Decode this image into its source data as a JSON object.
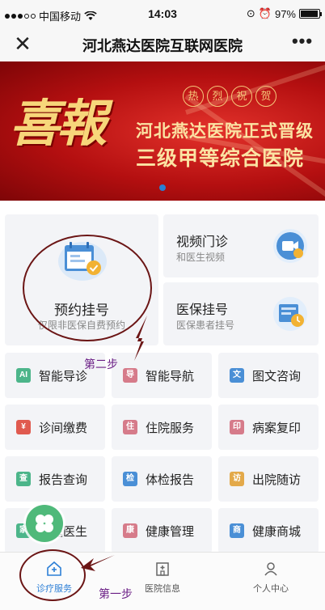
{
  "status": {
    "carrier": "中国移动",
    "time": "14:03",
    "battery": "97%"
  },
  "nav": {
    "close": "✕",
    "title": "河北燕达医院互联网医院",
    "more": "•••"
  },
  "banner": {
    "big_text": "喜報",
    "stamps": [
      "热",
      "烈",
      "祝",
      "贺"
    ],
    "line1": "河北燕达医院正式晋级",
    "line2": "三级甲等综合医院"
  },
  "services": {
    "appointment": {
      "label": "预约挂号",
      "sub": "仅限非医保自费预约"
    },
    "video": {
      "label": "视频门诊",
      "sub": "和医生视频"
    },
    "insurance": {
      "label": "医保挂号",
      "sub": "医保患者挂号"
    },
    "items": [
      {
        "label": "智能导诊",
        "icon": "AI",
        "color": "#4cb58a"
      },
      {
        "label": "智能导航",
        "icon": "导",
        "color": "#d67b8a"
      },
      {
        "label": "图文咨询",
        "icon": "文",
        "color": "#4a8fd6"
      },
      {
        "label": "诊间缴费",
        "icon": "¥",
        "color": "#e05a4f"
      },
      {
        "label": "住院服务",
        "icon": "住",
        "color": "#d67b8a"
      },
      {
        "label": "病案复印",
        "icon": "印",
        "color": "#d67b8a"
      },
      {
        "label": "报告查询",
        "icon": "查",
        "color": "#4cb58a"
      },
      {
        "label": "体检报告",
        "icon": "检",
        "color": "#4a8fd6"
      },
      {
        "label": "出院随访",
        "icon": "访",
        "color": "#e3a94a"
      },
      {
        "label": "家庭医生",
        "icon": "家",
        "color": "#4cb58a"
      },
      {
        "label": "健康管理",
        "icon": "康",
        "color": "#d67b8a"
      },
      {
        "label": "健康商城",
        "icon": "商",
        "color": "#4a8fd6"
      }
    ]
  },
  "tabs": [
    {
      "label": "诊疗服务"
    },
    {
      "label": "医院信息"
    },
    {
      "label": "个人中心"
    }
  ],
  "annotations": {
    "step1": "第一步",
    "step2": "第二步"
  },
  "colors": {
    "accent": "#2d7fd6",
    "banner_red": "#b40f10",
    "annotation": "#6b1f86"
  }
}
